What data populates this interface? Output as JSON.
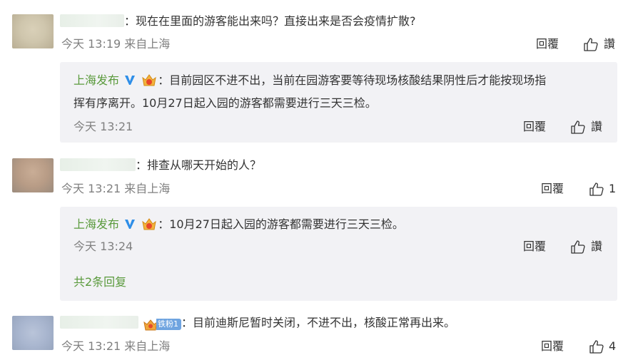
{
  "comments": [
    {
      "text": "：现在在里面的游客能出来吗？直接出来是否会疫情扩散?",
      "time": "今天 13:19 来自上海",
      "reply_label": "回覆",
      "like_label": "讚",
      "reply": {
        "author": "上海发布",
        "line1": "：目前园区不进不出，当前在园游客要等待现场核酸结果阴性后才能按现场指",
        "line2": "挥有序离开。10月27日起入园的游客都需要进行三天三检。",
        "time": "今天 13:21",
        "reply_label": "回覆",
        "like_label": "讚"
      }
    },
    {
      "text": "：排查从哪天开始的人？",
      "time": "今天 13:21 来自上海",
      "reply_label": "回覆",
      "like_count": "1",
      "reply": {
        "author": "上海发布",
        "line1": "：10月27日起入园的游客都需要进行三天三检。",
        "time": "今天 13:24",
        "reply_label": "回覆",
        "like_label": "讚"
      },
      "more_replies": "共2条回复"
    },
    {
      "fan_badge": "铁粉1",
      "text": "：目前迪斯尼暂时关闭，不进不出，核酸正常再出来。",
      "time": "今天 13:21 来自上海",
      "reply_label": "回覆",
      "like_count": "4"
    }
  ]
}
